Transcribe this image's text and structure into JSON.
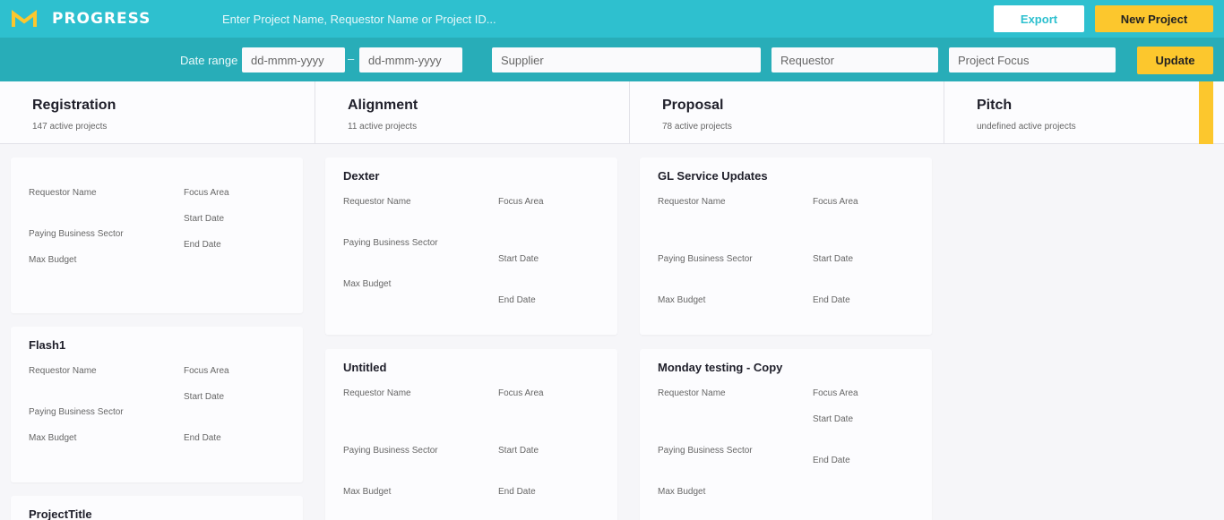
{
  "header": {
    "logo_text": "PROGRESS",
    "search_placeholder": "Enter Project Name, Requestor Name or Project ID...",
    "export_label": "Export",
    "new_project_label": "New Project"
  },
  "filters": {
    "date_range_label": "Date range",
    "date_from_placeholder": "dd-mmm-yyyy",
    "date_separator": "–",
    "date_to_placeholder": "dd-mmm-yyyy",
    "supplier_placeholder": "Supplier",
    "requestor_placeholder": "Requestor",
    "project_focus_placeholder": "Project Focus",
    "update_label": "Update"
  },
  "columns": [
    {
      "title": "Registration",
      "subtitle": "147 active projects"
    },
    {
      "title": "Alignment",
      "subtitle": "11 active projects"
    },
    {
      "title": "Proposal",
      "subtitle": "78 active projects"
    },
    {
      "title": "Pitch",
      "subtitle": "undefined active projects"
    }
  ],
  "card_labels": {
    "requestor": "Requestor Name",
    "focus": "Focus Area",
    "sector": "Paying Business Sector",
    "budget": "Max Budget",
    "start": "Start Date",
    "end": "End Date"
  },
  "cards": {
    "registration": [
      {
        "title": ""
      },
      {
        "title": "Flash1"
      },
      {
        "title": "ProjectTitle"
      }
    ],
    "alignment": [
      {
        "title": "Dexter"
      },
      {
        "title": "Untitled"
      }
    ],
    "proposal": [
      {
        "title": "GL Service Updates"
      },
      {
        "title": "Monday testing - Copy"
      }
    ]
  },
  "colors": {
    "topbar": "#2ec0cf",
    "filterbar": "#28adb8",
    "accent_yellow": "#fcc72d"
  }
}
